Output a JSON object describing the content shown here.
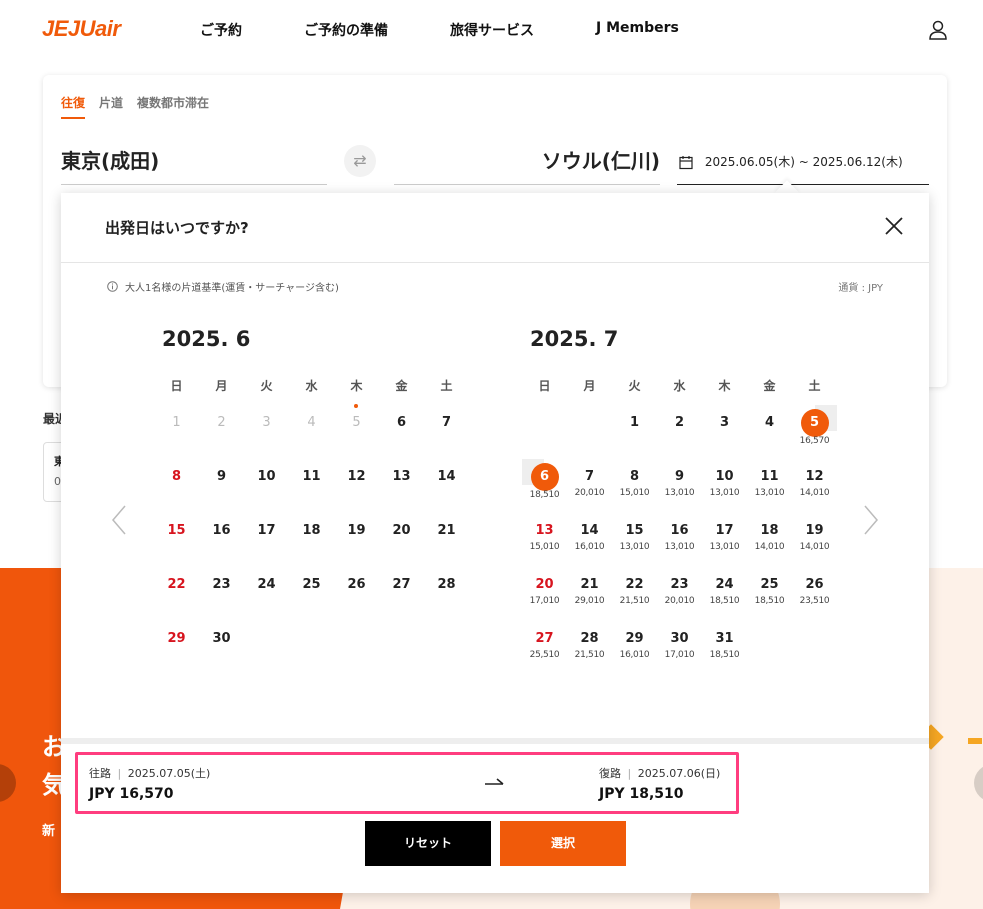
{
  "header": {
    "logo": "JEJUair",
    "nav": [
      "ご予約",
      "ご予約の準備",
      "旅得サービス",
      "J Members"
    ]
  },
  "search": {
    "trip_types": [
      "往復",
      "片道",
      "複数都市滞在"
    ],
    "origin": "東京(成田)",
    "destination": "ソウル(仁川)",
    "dates": "2025.06.05(木) ~ 2025.06.12(木)"
  },
  "background": {
    "recent_label": "最近",
    "recent_card_line1": "東",
    "recent_card_line2": "0",
    "banner_line1": "お",
    "banner_line2": "気",
    "banner_sub": "新"
  },
  "modal": {
    "title": "出発日はいつですか?",
    "note": "大人1名様の片道基準(運賃・サーチャージ含む)",
    "currency": "通貨 : JPY",
    "weekdays": [
      "日",
      "月",
      "火",
      "水",
      "木",
      "金",
      "土"
    ],
    "months": [
      {
        "title": "2025. 6",
        "offset": 0,
        "days": [
          {
            "d": "1",
            "p": "",
            "state": "disabled"
          },
          {
            "d": "2",
            "p": "",
            "state": "disabled"
          },
          {
            "d": "3",
            "p": "",
            "state": "disabled"
          },
          {
            "d": "4",
            "p": "",
            "state": "disabled"
          },
          {
            "d": "5",
            "p": "",
            "state": "disabled-today"
          },
          {
            "d": "6",
            "p": "",
            "state": ""
          },
          {
            "d": "7",
            "p": "",
            "state": ""
          },
          {
            "d": "8",
            "p": "",
            "state": ""
          },
          {
            "d": "9",
            "p": "",
            "state": ""
          },
          {
            "d": "10",
            "p": "",
            "state": ""
          },
          {
            "d": "11",
            "p": "",
            "state": ""
          },
          {
            "d": "12",
            "p": "",
            "state": ""
          },
          {
            "d": "13",
            "p": "",
            "state": ""
          },
          {
            "d": "14",
            "p": "",
            "state": ""
          },
          {
            "d": "15",
            "p": "",
            "state": ""
          },
          {
            "d": "16",
            "p": "",
            "state": ""
          },
          {
            "d": "17",
            "p": "",
            "state": ""
          },
          {
            "d": "18",
            "p": "",
            "state": ""
          },
          {
            "d": "19",
            "p": "",
            "state": ""
          },
          {
            "d": "20",
            "p": "",
            "state": ""
          },
          {
            "d": "21",
            "p": "",
            "state": ""
          },
          {
            "d": "22",
            "p": "",
            "state": ""
          },
          {
            "d": "23",
            "p": "",
            "state": ""
          },
          {
            "d": "24",
            "p": "",
            "state": ""
          },
          {
            "d": "25",
            "p": "",
            "state": ""
          },
          {
            "d": "26",
            "p": "",
            "state": ""
          },
          {
            "d": "27",
            "p": "",
            "state": ""
          },
          {
            "d": "28",
            "p": "",
            "state": ""
          },
          {
            "d": "29",
            "p": "",
            "state": ""
          },
          {
            "d": "30",
            "p": "",
            "state": ""
          }
        ]
      },
      {
        "title": "2025. 7",
        "offset": 2,
        "days": [
          {
            "d": "1",
            "p": "",
            "state": ""
          },
          {
            "d": "2",
            "p": "",
            "state": ""
          },
          {
            "d": "3",
            "p": "",
            "state": ""
          },
          {
            "d": "4",
            "p": "",
            "state": ""
          },
          {
            "d": "5",
            "p": "16,570",
            "state": "sel-start"
          },
          {
            "d": "6",
            "p": "18,510",
            "state": "sel-end"
          },
          {
            "d": "7",
            "p": "20,010",
            "state": ""
          },
          {
            "d": "8",
            "p": "15,010",
            "state": ""
          },
          {
            "d": "9",
            "p": "13,010",
            "state": ""
          },
          {
            "d": "10",
            "p": "13,010",
            "state": ""
          },
          {
            "d": "11",
            "p": "13,010",
            "state": ""
          },
          {
            "d": "12",
            "p": "14,010",
            "state": ""
          },
          {
            "d": "13",
            "p": "15,010",
            "state": ""
          },
          {
            "d": "14",
            "p": "16,010",
            "state": ""
          },
          {
            "d": "15",
            "p": "13,010",
            "state": ""
          },
          {
            "d": "16",
            "p": "13,010",
            "state": ""
          },
          {
            "d": "17",
            "p": "13,010",
            "state": ""
          },
          {
            "d": "18",
            "p": "14,010",
            "state": ""
          },
          {
            "d": "19",
            "p": "14,010",
            "state": ""
          },
          {
            "d": "20",
            "p": "17,010",
            "state": ""
          },
          {
            "d": "21",
            "p": "29,010",
            "state": ""
          },
          {
            "d": "22",
            "p": "21,510",
            "state": ""
          },
          {
            "d": "23",
            "p": "20,010",
            "state": ""
          },
          {
            "d": "24",
            "p": "18,510",
            "state": ""
          },
          {
            "d": "25",
            "p": "18,510",
            "state": ""
          },
          {
            "d": "26",
            "p": "23,510",
            "state": ""
          },
          {
            "d": "27",
            "p": "25,510",
            "state": ""
          },
          {
            "d": "28",
            "p": "21,510",
            "state": ""
          },
          {
            "d": "29",
            "p": "16,010",
            "state": ""
          },
          {
            "d": "30",
            "p": "17,010",
            "state": ""
          },
          {
            "d": "31",
            "p": "18,510",
            "state": ""
          }
        ]
      }
    ],
    "summary": {
      "outbound_label": "往路",
      "outbound_date": "2025.07.05(土)",
      "outbound_price": "JPY 16,570",
      "return_label": "復路",
      "return_date": "2025.07.06(日)",
      "return_price": "JPY 18,510"
    },
    "buttons": {
      "reset": "リセット",
      "select": "選択"
    }
  },
  "colors": {
    "brand": "#f05a0a",
    "sunday": "#d7141e",
    "highlight_border": "#ff3d7f"
  }
}
